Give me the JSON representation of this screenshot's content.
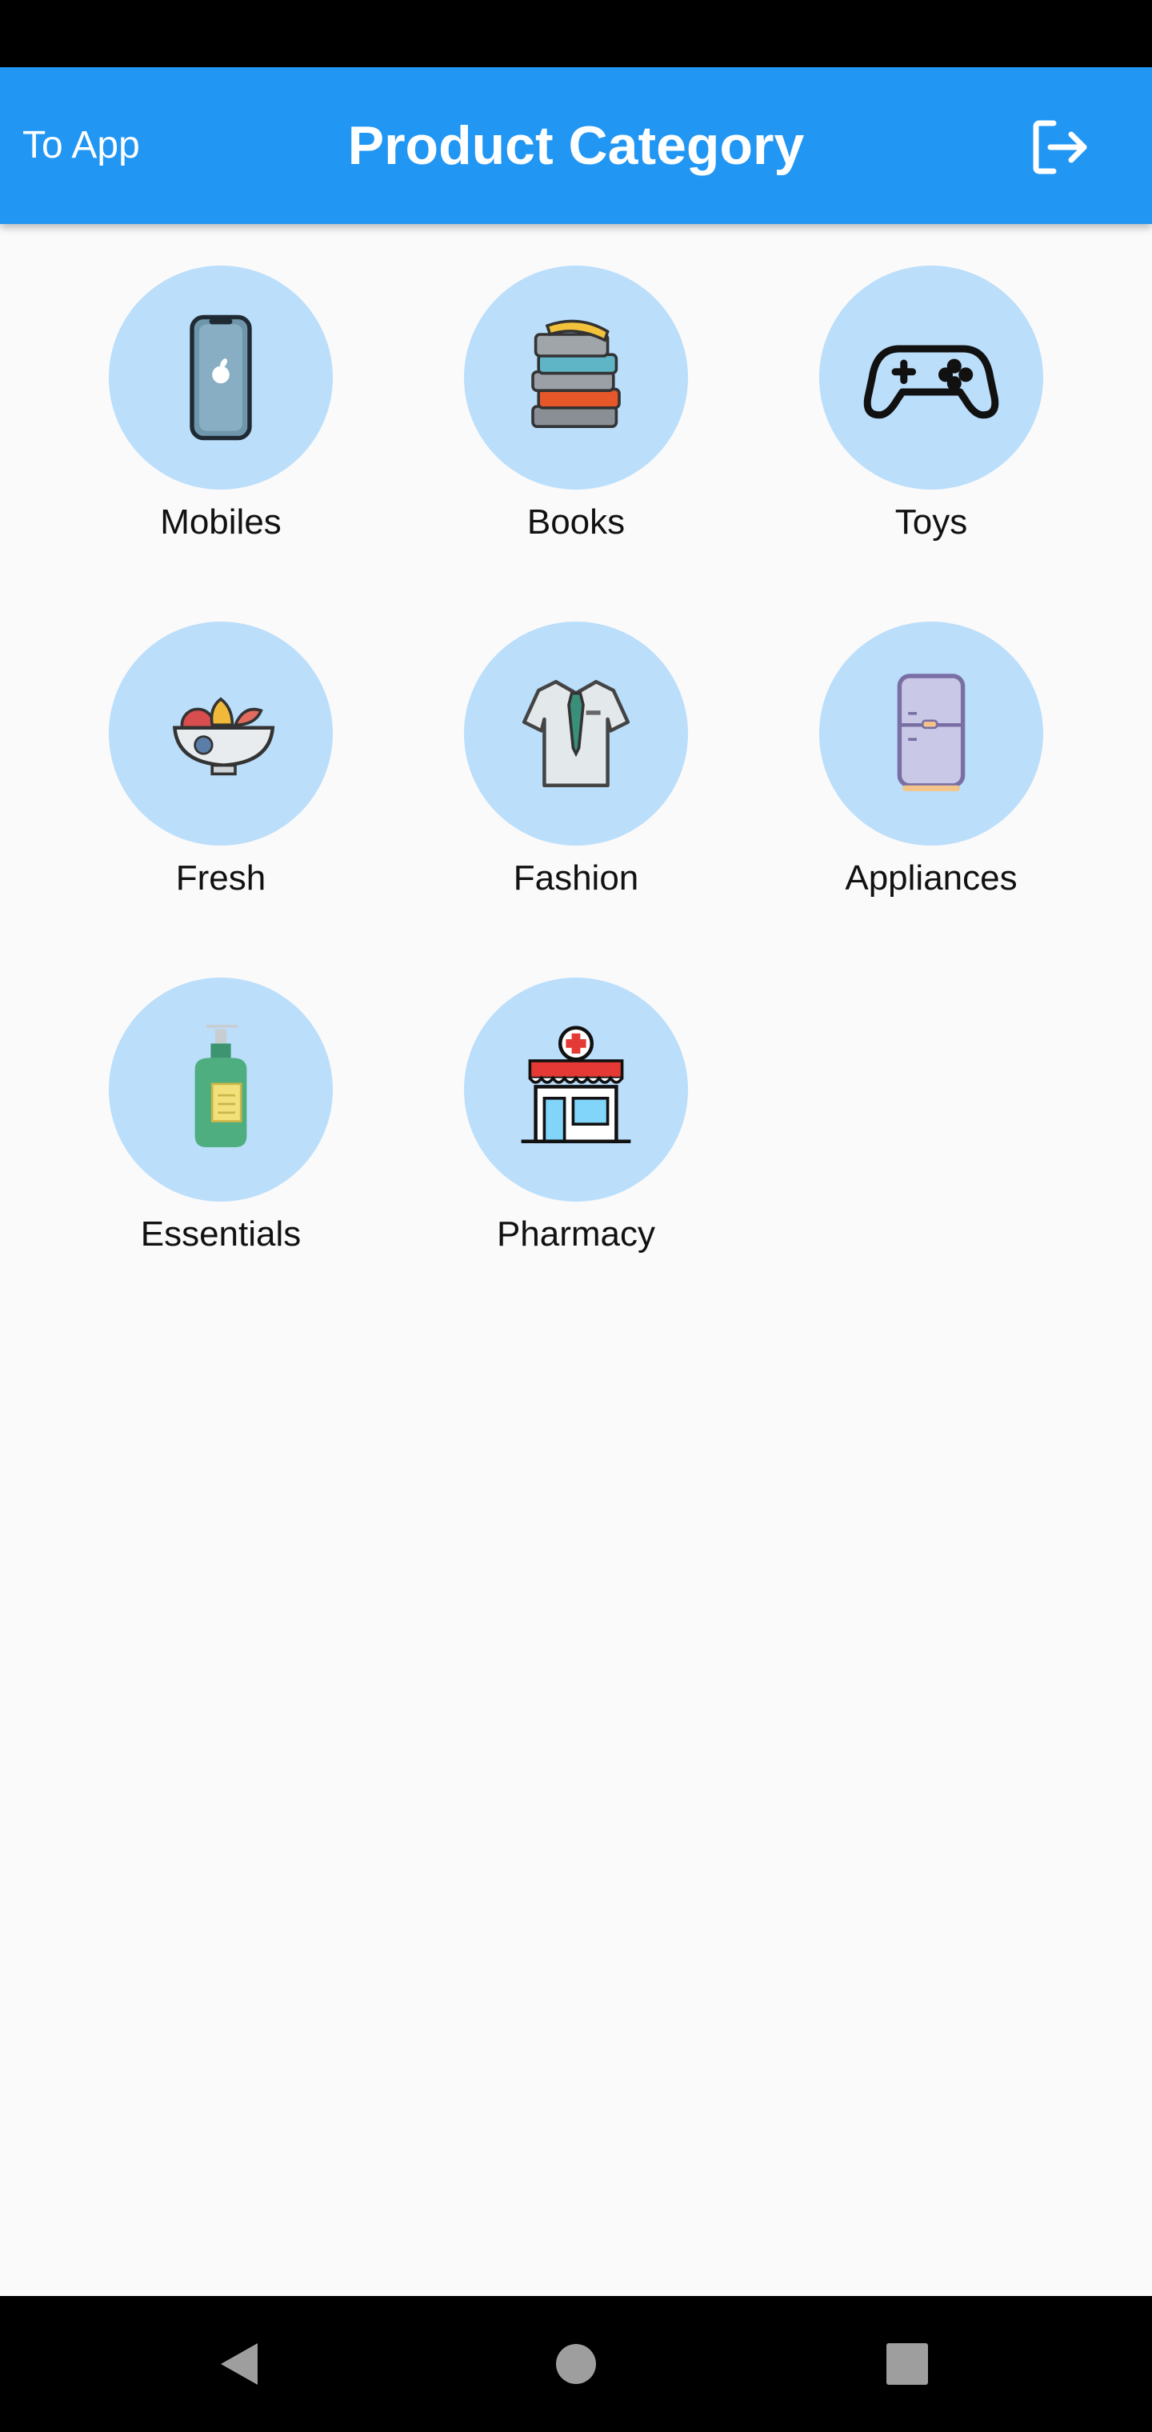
{
  "app_bar": {
    "back_label": "To App",
    "title": "Product Category",
    "logout_icon": "logout-icon",
    "color": "#2196f3"
  },
  "categories": [
    {
      "label": "Mobiles",
      "icon": "mobile-phone-icon"
    },
    {
      "label": "Books",
      "icon": "books-stack-icon"
    },
    {
      "label": "Toys",
      "icon": "gamepad-icon"
    },
    {
      "label": "Fresh",
      "icon": "fruit-bowl-icon"
    },
    {
      "label": "Fashion",
      "icon": "shirt-tie-icon"
    },
    {
      "label": "Appliances",
      "icon": "refrigerator-icon"
    },
    {
      "label": "Essentials",
      "icon": "soap-bottle-icon"
    },
    {
      "label": "Pharmacy",
      "icon": "pharmacy-store-icon"
    }
  ],
  "category_circle_color": "#bbdefb",
  "nav_bar": {
    "back_icon": "nav-back-icon",
    "home_icon": "nav-home-icon",
    "recents_icon": "nav-recents-icon"
  }
}
